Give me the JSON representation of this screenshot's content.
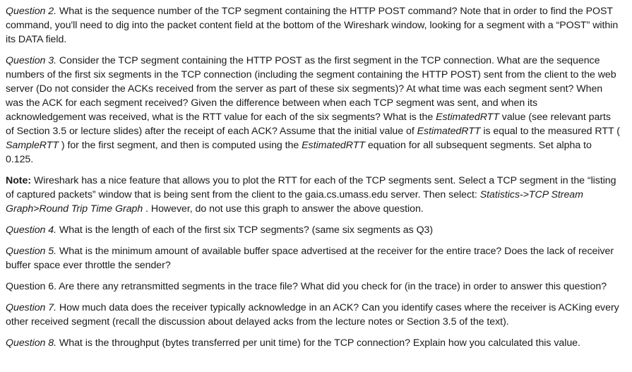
{
  "q2": {
    "label": "Question 2.",
    "text": " What is the sequence number of the TCP segment containing the HTTP POST command? Note that in order to find the POST command, you'll need to dig into the packet content field at the bottom of the Wireshark window, looking for a segment with a “POST” within its DATA field."
  },
  "q3": {
    "label": "Question 3.",
    "t1": " Consider the TCP segment containing the HTTP POST as the first segment in the TCP connection. What are the sequence numbers of the first six segments in the TCP connection (including the segment containing the HTTP POST) sent from the client to the web server (Do not consider the ACKs received from the server as part of these six segments)? At what time was each segment sent? When was the ACK for each segment received? Given the difference between when each TCP segment was sent, and when its acknowledgement was received, what is the RTT value for each of the six segments? What is the ",
    "i1": "EstimatedRTT",
    "t2": " value (see relevant parts of Section 3.5 or lecture slides) after the receipt of each ACK? Assume that the initial value of ",
    "i2": "EstimatedRTT",
    "t3": " is equal to the measured RTT ( ",
    "i3": "SampleRTT",
    "t4": " ) for the first segment, and then is computed using the ",
    "i4": "EstimatedRTT",
    "t5": " equation for all subsequent segments. Set alpha to 0.125."
  },
  "note": {
    "label": "Note:",
    "t1": " Wireshark has a nice feature that allows you to plot the RTT for each of the TCP segments sent. Select a TCP segment in the “listing of captured packets” window that is being sent from the client to the gaia.cs.umass.edu server. Then select: ",
    "i1": "Statistics->TCP Stream Graph>Round Trip Time Graph",
    "t2": " . However, do not use this graph to answer the above question."
  },
  "q4": {
    "label": "Question 4.",
    "text": " What is the length of each of the first six TCP segments? (same six segments as Q3)"
  },
  "q5": {
    "label": "Question 5.",
    "text": " What is the minimum amount of available buffer space advertised at the receiver for the entire trace? Does the lack of receiver buffer space ever throttle the sender?"
  },
  "q6": {
    "text": "Question 6. Are there any retransmitted segments in the trace file? What did you check for (in the trace) in order to answer this question?"
  },
  "q7": {
    "label": "Question 7.",
    "text": " How much data does the receiver typically acknowledge in an ACK? Can you identify cases where the receiver is ACKing every other received segment (recall the discussion about delayed acks from the lecture notes or Section 3.5 of the text)."
  },
  "q8": {
    "label": "Question 8.",
    "text": " What is the throughput (bytes transferred per unit time) for the TCP connection? Explain how you calculated this value."
  }
}
